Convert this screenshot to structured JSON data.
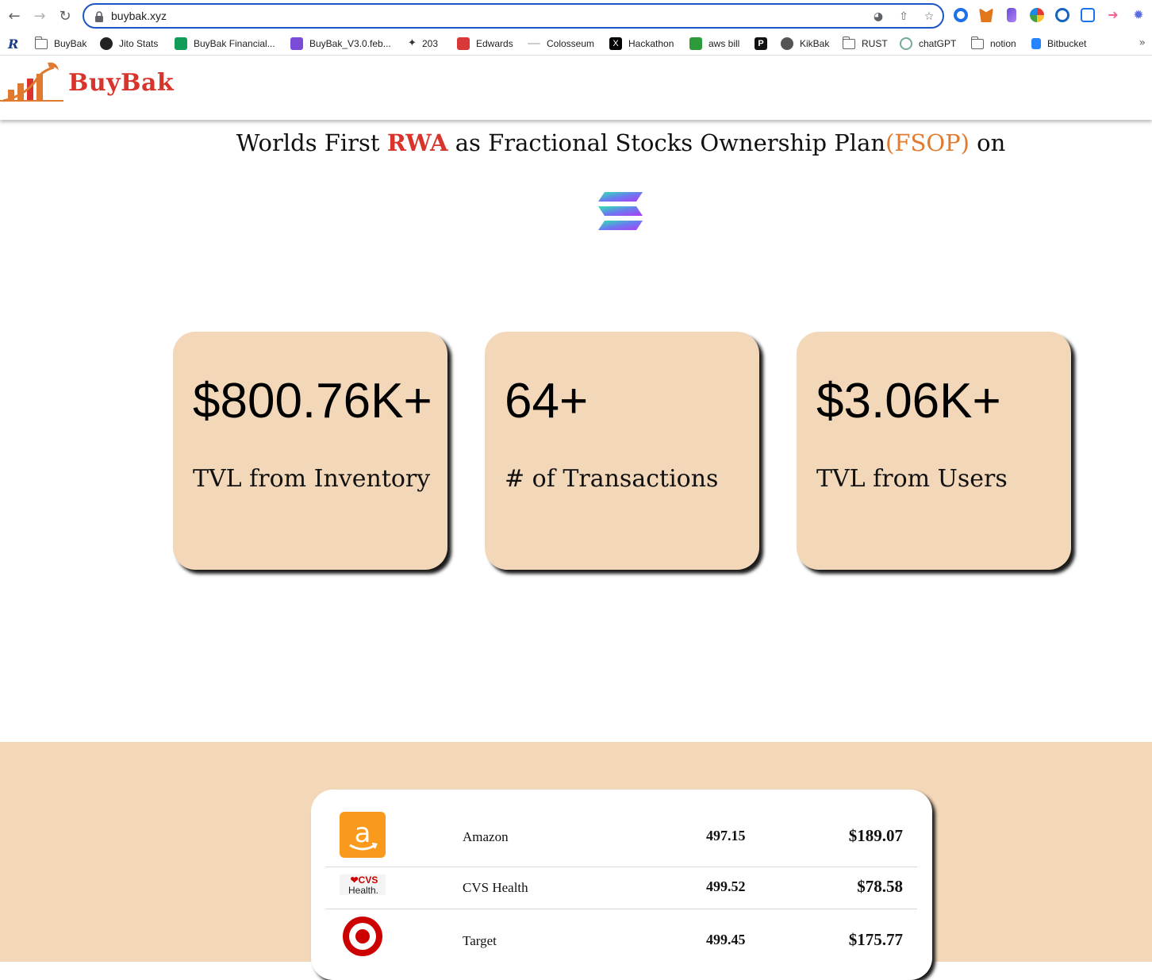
{
  "browser": {
    "url": "buybak.xyz",
    "bookmarks": [
      {
        "label": "BuyBak",
        "icon": "folder-icon"
      },
      {
        "label": "Jito Stats",
        "icon": "jito-icon"
      },
      {
        "label": "BuyBak Financial...",
        "icon": "sheets-icon"
      },
      {
        "label": "BuyBak_V3.0.feb...",
        "icon": "doc-icon"
      },
      {
        "label": "203",
        "icon": "figure-icon"
      },
      {
        "label": "Edwards",
        "icon": "calendar-icon"
      },
      {
        "label": "Colosseum",
        "icon": "colosseum-icon"
      },
      {
        "label": "Hackathon",
        "icon": "x-icon"
      },
      {
        "label": "aws bill",
        "icon": "aws-icon"
      },
      {
        "label": "",
        "icon": "p-icon"
      },
      {
        "label": "KikBak",
        "icon": "globe-icon"
      },
      {
        "label": "RUST",
        "icon": "folder-icon"
      },
      {
        "label": "chatGPT",
        "icon": "chatgpt-icon"
      },
      {
        "label": "notion",
        "icon": "folder-icon"
      },
      {
        "label": "Bitbucket",
        "icon": "bitbucket-icon"
      }
    ]
  },
  "site": {
    "brand": "BuyBak",
    "hero": {
      "prefix": "Worlds First ",
      "rwa": "RWA",
      "middle": " as Fractional Stocks Ownership Plan",
      "fsop": "(FSOP)",
      "suffix": " on"
    },
    "stats": [
      {
        "value": "$800.76K+",
        "label": "TVL from Inventory"
      },
      {
        "value": "64+",
        "label": "# of Transactions"
      },
      {
        "value": "$3.06K+",
        "label": "TVL from Users"
      }
    ],
    "stocks": [
      {
        "name": "Amazon",
        "qty": "497.15",
        "price": "$189.07",
        "logo": "amazon-logo"
      },
      {
        "name": "CVS Health",
        "qty": "499.52",
        "price": "$78.58",
        "logo": "cvs-logo"
      },
      {
        "name": "Target",
        "qty": "499.45",
        "price": "$175.77",
        "logo": "target-logo"
      }
    ],
    "colors": {
      "accent_red": "#d9342b",
      "accent_orange": "#e07a2f",
      "card_bg": "#f3d7b9"
    }
  }
}
